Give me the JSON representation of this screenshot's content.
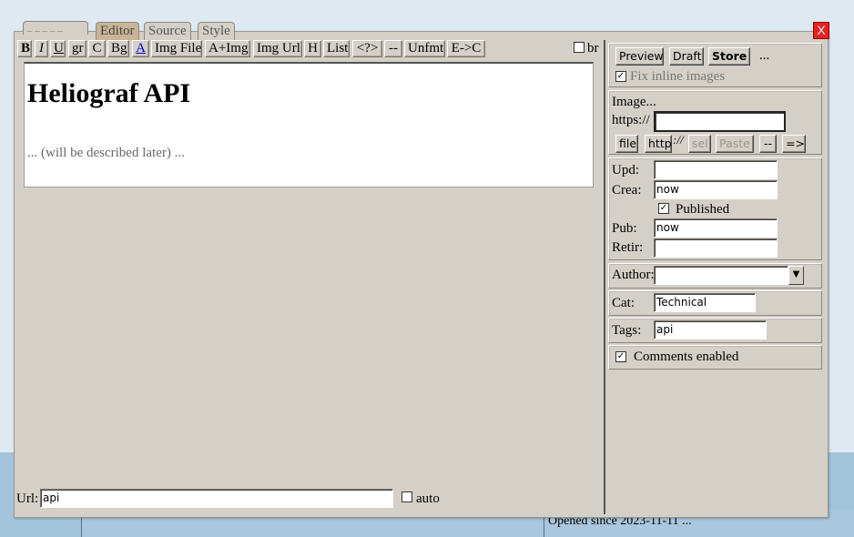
{
  "tabs": {
    "blank": "_ _ _ _ _",
    "editor": "Editor",
    "source": "Source",
    "style": "Style"
  },
  "close_label": "X",
  "toolbar": {
    "bold": "B",
    "italic": "I",
    "underline": "U",
    "gr": "gr",
    "c": "C",
    "bg": "Bg",
    "a": "A",
    "img_file": "Img File",
    "a_img": "A+Img",
    "img_url": "Img Url",
    "h": "H",
    "list": "List",
    "code": "<?>",
    "dash": "--",
    "unfmt": "Unfmt",
    "e_c": "E->C",
    "br_label": "br"
  },
  "editor": {
    "title": "Heliograf API",
    "description": "... (will be described later) ..."
  },
  "url": {
    "label": "Url:",
    "value": "api",
    "auto_label": "auto"
  },
  "side": {
    "preview": "Preview",
    "draft": "Draft",
    "store": "Store",
    "more": "...",
    "fix_inline": "Fix inline images",
    "image_label": "Image...",
    "https_label": "https://",
    "https_value": "",
    "file": "file",
    "http": "http",
    "sep": "://",
    "sel": "sel",
    "paste": "Paste",
    "dash": "--",
    "arrow": "=>",
    "upd_label": "Upd:",
    "upd_value": "",
    "crea_label": "Crea:",
    "crea_value": "now",
    "published_label": "Published",
    "pub_label": "Pub:",
    "pub_value": "now",
    "retir_label": "Retir:",
    "retir_value": "",
    "author_label": "Author:",
    "author_value": "",
    "cat_label": "Cat:",
    "cat_value": "Technical",
    "tags_label": "Tags:",
    "tags_value": "api",
    "comments_label": "Comments enabled"
  },
  "status_text": "Opened since 2023-11-11 ..."
}
